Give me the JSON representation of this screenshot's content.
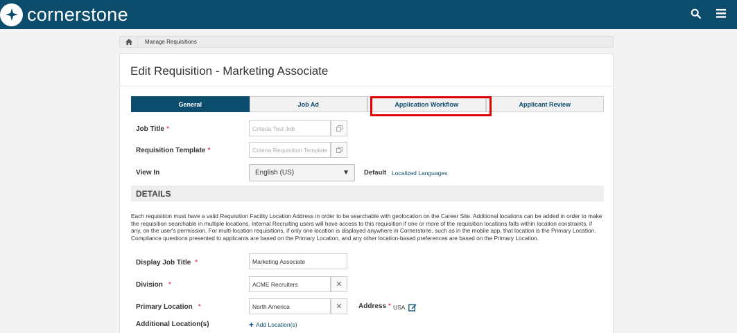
{
  "app": {
    "brand": "cornerstone"
  },
  "header": {
    "search_icon": "search-icon",
    "menu_icon": "hamburger-menu-icon"
  },
  "breadcrumb": {
    "home_icon": "home-icon",
    "current": "Manage Requisitions"
  },
  "page": {
    "title": "Edit Requisition - Marketing Associate"
  },
  "tabs": [
    {
      "label": "General",
      "active": true
    },
    {
      "label": "Job Ad",
      "active": false
    },
    {
      "label": "Application Workflow",
      "active": false
    },
    {
      "label": "Applicant Review",
      "active": false
    }
  ],
  "form": {
    "job_title": {
      "label": "Job Title",
      "required": "*",
      "placeholder": "Criteria Test Job"
    },
    "requisition_template": {
      "label": "Requisition Template",
      "required": "*",
      "placeholder": "Criteria Requisition Template -"
    },
    "view_in": {
      "label": "View In",
      "selected": "English (US)",
      "default_label": "Default",
      "localized_link": "Localized Languages"
    }
  },
  "details": {
    "heading": "DETAILS",
    "description": "Each requisition must have a valid Requisition Facility Location Address in order to be searchable with geolocation on the Career Site. Additional locations can be added in order to make the requisition searchable in multiple locations. Internal Recruiting users will have access to this requisition if one or more of the requisition locations falls within location constraints, if any, on the user's permission. For multi-location requisitions, if only one location is displayed anywhere in Cornerstone, such as in the mobile app, that location is the Primary Location. Compliance questions presented to applicants are based on the Primary Location, and any other location-based preferences are based on the Primary Location.",
    "display_job_title": {
      "label": "Display Job Title",
      "required": "*",
      "value": "Marketing Associate"
    },
    "division": {
      "label": "Division",
      "required": "*",
      "value": "ACME Recruiters"
    },
    "primary_location": {
      "label": "Primary Location",
      "required": "*",
      "value": "North America"
    },
    "address": {
      "label": "Address",
      "required": "*",
      "value": "USA"
    },
    "additional_locations": {
      "label": "Additional Location(s)",
      "add_link": "Add Location(s)"
    }
  },
  "colors": {
    "brand": "#0c4d6e",
    "highlight": "#e00000",
    "required": "#d0021b"
  }
}
